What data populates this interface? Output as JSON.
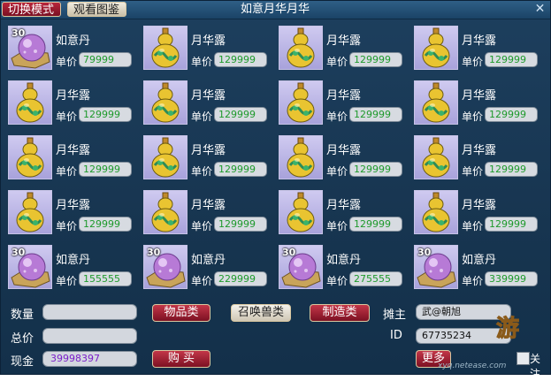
{
  "window": {
    "title": "如意月华月华",
    "mode_button": "切换模式",
    "catalog_button": "观看图鉴",
    "close_glyph": "✕"
  },
  "price_label": "单价",
  "items": [
    {
      "name": "如意丹",
      "price": "79999",
      "icon": "pearl-icon",
      "badge": "30"
    },
    {
      "name": "月华露",
      "price": "129999",
      "icon": "gourd-icon",
      "badge": ""
    },
    {
      "name": "月华露",
      "price": "129999",
      "icon": "gourd-icon",
      "badge": ""
    },
    {
      "name": "月华露",
      "price": "129999",
      "icon": "gourd-icon",
      "badge": ""
    },
    {
      "name": "月华露",
      "price": "129999",
      "icon": "gourd-icon",
      "badge": ""
    },
    {
      "name": "月华露",
      "price": "129999",
      "icon": "gourd-icon",
      "badge": ""
    },
    {
      "name": "月华露",
      "price": "129999",
      "icon": "gourd-icon",
      "badge": ""
    },
    {
      "name": "月华露",
      "price": "129999",
      "icon": "gourd-icon",
      "badge": ""
    },
    {
      "name": "月华露",
      "price": "129999",
      "icon": "gourd-icon",
      "badge": ""
    },
    {
      "name": "月华露",
      "price": "129999",
      "icon": "gourd-icon",
      "badge": ""
    },
    {
      "name": "月华露",
      "price": "129999",
      "icon": "gourd-icon",
      "badge": ""
    },
    {
      "name": "月华露",
      "price": "129999",
      "icon": "gourd-icon",
      "badge": ""
    },
    {
      "name": "月华露",
      "price": "129999",
      "icon": "gourd-icon",
      "badge": ""
    },
    {
      "name": "月华露",
      "price": "129999",
      "icon": "gourd-icon",
      "badge": ""
    },
    {
      "name": "月华露",
      "price": "129999",
      "icon": "gourd-icon",
      "badge": ""
    },
    {
      "name": "月华露",
      "price": "129999",
      "icon": "gourd-icon",
      "badge": ""
    },
    {
      "name": "如意丹",
      "price": "155555",
      "icon": "pearl-icon",
      "badge": "30"
    },
    {
      "name": "如意丹",
      "price": "229999",
      "icon": "pearl-icon",
      "badge": "30"
    },
    {
      "name": "如意丹",
      "price": "275555",
      "icon": "pearl-icon",
      "badge": "30"
    },
    {
      "name": "如意丹",
      "price": "339999",
      "icon": "pearl-icon",
      "badge": "30"
    }
  ],
  "bottom": {
    "quantity_label": "数量",
    "quantity_value": "",
    "total_label": "总价",
    "total_value": "",
    "cash_label": "现金",
    "cash_value": "39998397",
    "tab_items": "物品类",
    "tab_summon": "召唤兽类",
    "tab_craft": "制造类",
    "buy_button": "购 买",
    "owner_label": "摊主",
    "owner_value": "武@朝旭",
    "id_label": "ID",
    "id_value": "67735234",
    "more_button": "更多",
    "follow_label": "关注",
    "watermark_logo": "游",
    "watermark_url": "xyq.netease.com"
  },
  "colors": {
    "price_text": "#1e9a2c",
    "cash_text": "#7a1ec8",
    "accent_red": "#b8263b"
  }
}
